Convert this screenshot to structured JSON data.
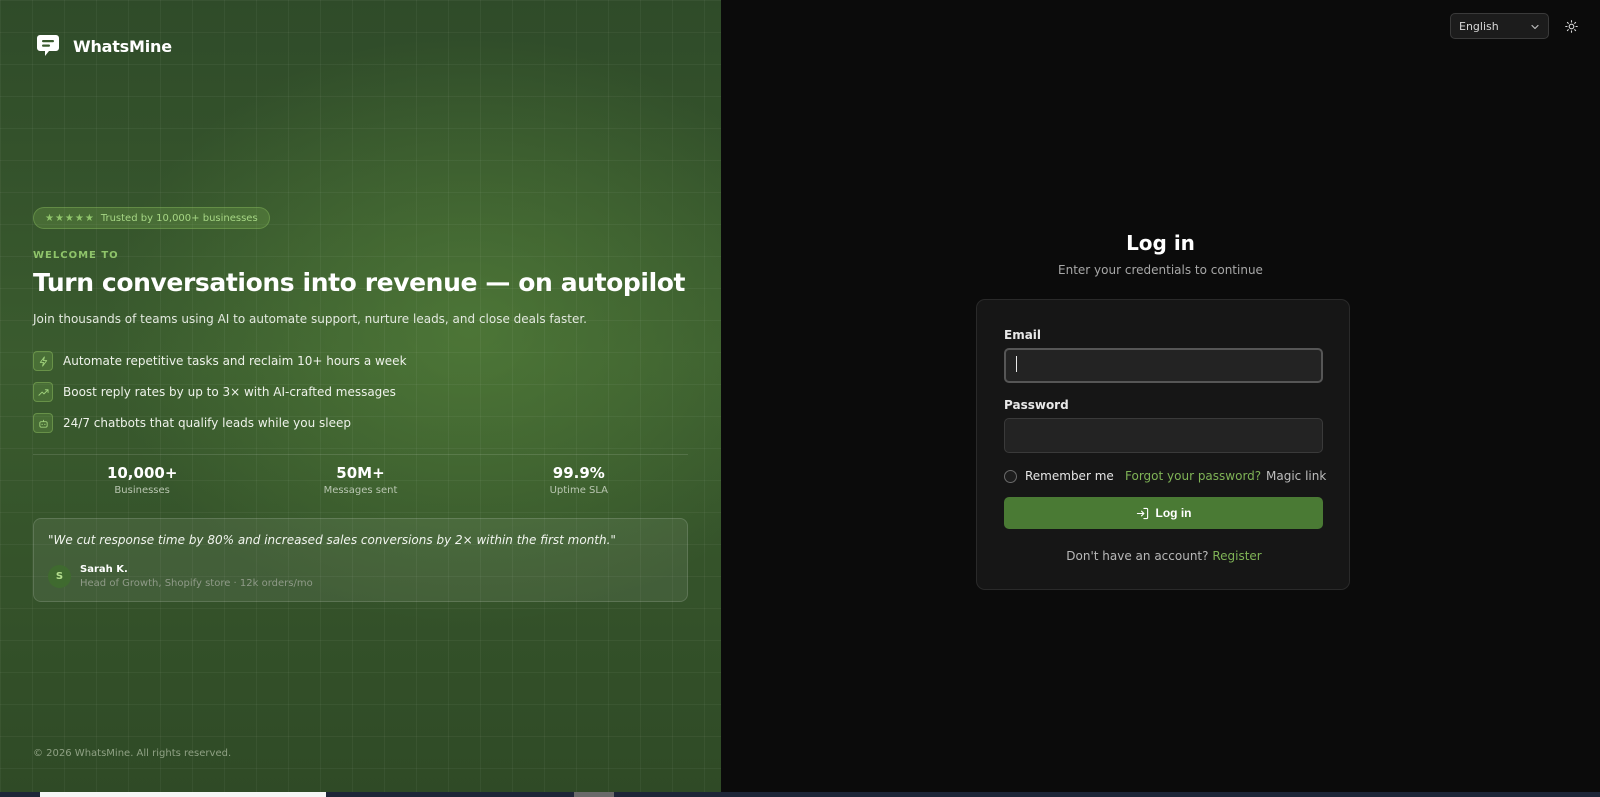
{
  "brand": {
    "name": "WhatsMine",
    "icon": "chat-bubble-icon"
  },
  "hero": {
    "trust_badge": {
      "stars": "★★★★★",
      "text": "Trusted by 10,000+ businesses"
    },
    "eyebrow": "WELCOME TO",
    "headline": "Turn conversations into revenue — on autopilot",
    "subhead": "Join thousands of teams using AI to automate support, nurture leads, and close deals faster.",
    "features": [
      {
        "icon": "lightning-icon",
        "text": "Automate repetitive tasks and reclaim 10+ hours a week"
      },
      {
        "icon": "trending-up-icon",
        "text": "Boost reply rates by up to 3× with AI-crafted messages"
      },
      {
        "icon": "bot-icon",
        "text": "24/7 chatbots that qualify leads while you sleep"
      }
    ],
    "stats": [
      {
        "value": "10,000+",
        "label": "Businesses"
      },
      {
        "value": "50M+",
        "label": "Messages sent"
      },
      {
        "value": "99.9%",
        "label": "Uptime SLA"
      }
    ],
    "testimonial": {
      "quote": "\"We cut response time by 80% and increased sales conversions by 2× within the first month.\"",
      "avatar_initial": "S",
      "name": "Sarah K.",
      "role": "Head of Growth, Shopify store · 12k orders/mo"
    },
    "copyright": "© 2026 WhatsMine. All rights reserved."
  },
  "topbar": {
    "language": {
      "selected": "English",
      "icon": "chevron-down-icon"
    },
    "theme_toggle_icon": "sun-icon"
  },
  "login": {
    "title": "Log in",
    "subtitle": "Enter your credentials to continue",
    "email_label": "Email",
    "email_value": "",
    "password_label": "Password",
    "password_value": "",
    "remember_label": "Remember me",
    "remember_checked": false,
    "forgot_link": "Forgot your password?",
    "magic_link": "Magic link",
    "submit_label": "Log in",
    "submit_icon": "log-in-icon",
    "register_prompt": "Don't have an account?",
    "register_link": "Register"
  },
  "colors": {
    "accent": "#4a7a34",
    "link": "#7fb356",
    "left_panel": "#3a5b2e",
    "right_panel": "#0b0b0b"
  }
}
